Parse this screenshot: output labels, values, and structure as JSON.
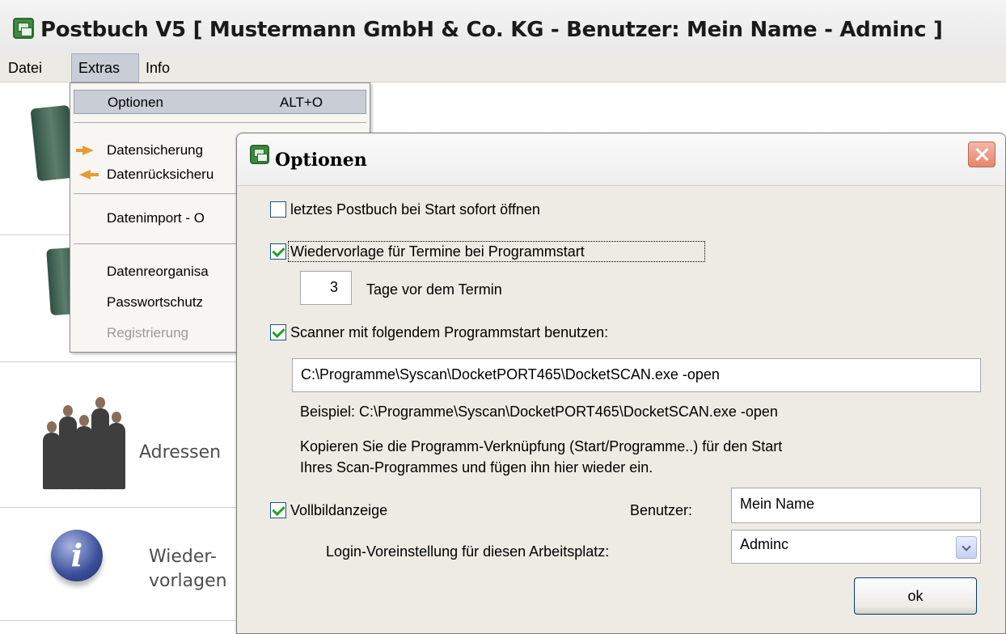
{
  "window": {
    "title": "Postbuch V5 [ Mustermann GmbH & Co. KG - Benutzer: Mein Name - Adminc ]"
  },
  "menubar": {
    "items": [
      "Datei",
      "Extras",
      "Info"
    ]
  },
  "left_panel": {
    "adressen_label": "Adressen",
    "wiedervorlagen_line1": "Wieder-",
    "wiedervorlagen_line2": "vorlagen"
  },
  "extras_menu": {
    "optionen": {
      "label": "Optionen",
      "accelerator": "ALT+O"
    },
    "datensicherung": "Datensicherung",
    "datenruecksicherung": "Datenrücksicheru",
    "datenimport": "Datenimport - O",
    "datenreorganisation": "Datenreorganisa",
    "passwortschutz": "Passwortschutz",
    "registrierung": "Registrierung"
  },
  "dialog": {
    "title": "Optionen",
    "open_last_postbuch": {
      "label": "letztes Postbuch bei Start sofort öffnen",
      "checked": false
    },
    "wiedervorlage": {
      "label": "Wiedervorlage für Termine bei Programmstart",
      "checked": true
    },
    "days_value": "3",
    "days_label": "Tage vor dem Termin",
    "scanner": {
      "label": "Scanner mit folgendem Programmstart benutzen:",
      "checked": true
    },
    "scanner_path": "C:\\Programme\\Syscan\\DocketPORT465\\DocketSCAN.exe -open",
    "example": "Beispiel: C:\\Programme\\Syscan\\DocketPORT465\\DocketSCAN.exe -open",
    "hint_line1": "Kopieren Sie die Programm-Verknüpfung (Start/Programme..) für den Start",
    "hint_line2": "Ihres Scan-Programmes und fügen ihn hier wieder ein.",
    "vollbild": {
      "label": "Vollbildanzeige",
      "checked": true
    },
    "benutzer_label": "Benutzer:",
    "benutzer_value": "Mein Name",
    "login_label": "Login-Voreinstellung für diesen Arbeitsplatz:",
    "login_value": "Adminc",
    "ok_label": "ok"
  },
  "colors": {
    "menu_highlight": "#c8cdd6",
    "dialog_bg": "#edebe3",
    "close_button": "#e7856a",
    "checkmark": "#21a121"
  },
  "icons": [
    "app-icon",
    "people-icon",
    "binder-icon",
    "info-icon",
    "backup-arrow-icon",
    "restore-arrow-icon",
    "close-icon",
    "chevron-down-icon"
  ]
}
